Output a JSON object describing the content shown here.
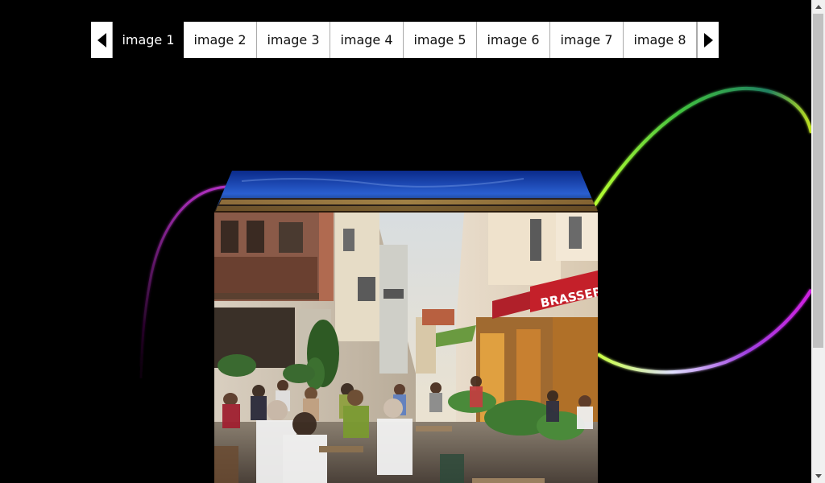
{
  "gallery": {
    "tabs": [
      {
        "label": "image 1",
        "active": true
      },
      {
        "label": "image 2",
        "active": false
      },
      {
        "label": "image 3",
        "active": false
      },
      {
        "label": "image 4",
        "active": false
      },
      {
        "label": "image 5",
        "active": false
      },
      {
        "label": "image 6",
        "active": false
      },
      {
        "label": "image 7",
        "active": false
      },
      {
        "label": "image 8",
        "active": false
      }
    ],
    "prev_icon": "triangle-left-icon",
    "next_icon": "triangle-right-icon"
  },
  "cube": {
    "front_image": "street cafe scene",
    "top_image": "night city skyline"
  },
  "signage": {
    "brasserie": "BRASSERIE"
  },
  "colors": {
    "background": "#000000",
    "tab_bg": "#ffffff",
    "active_tab_bg": "#000000",
    "ribbon_green": "#9be000",
    "ribbon_purple": "#c020e0"
  }
}
